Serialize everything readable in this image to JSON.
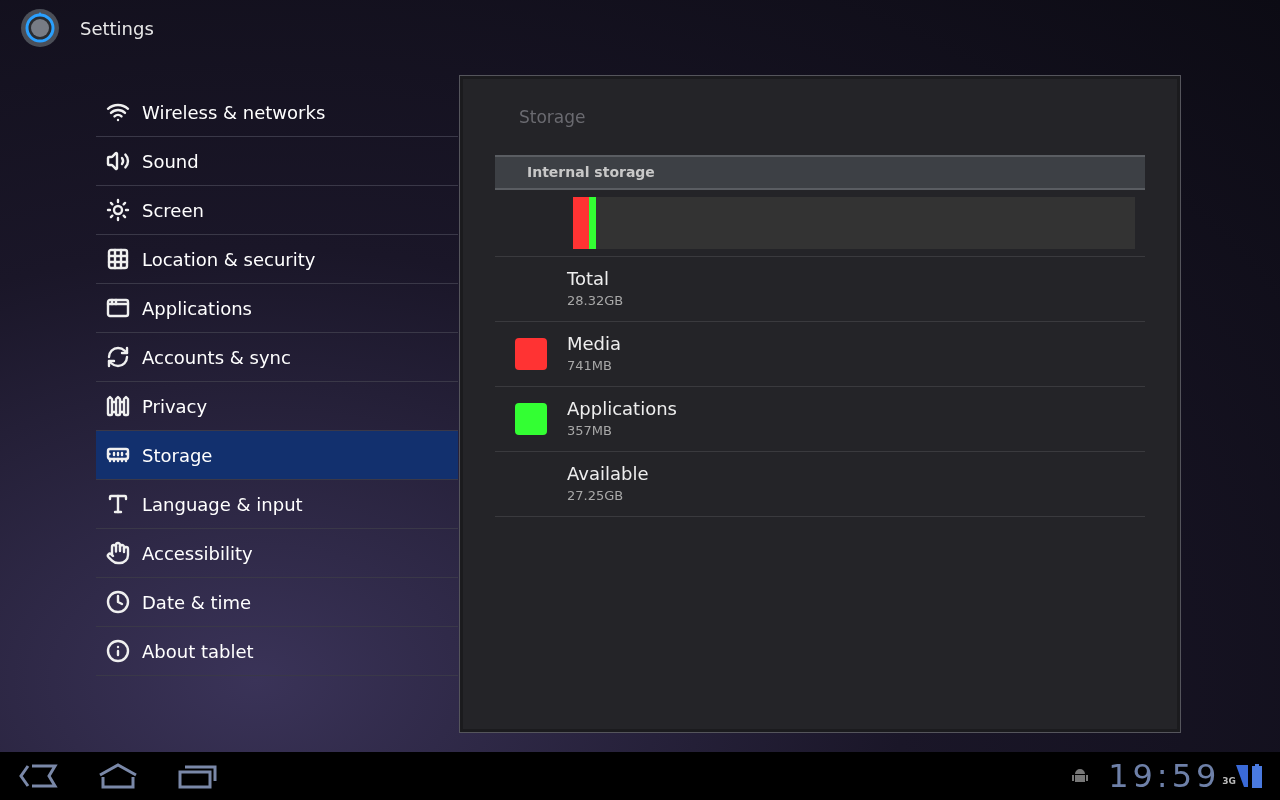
{
  "app_bar": {
    "title": "Settings"
  },
  "sidebar": {
    "items": [
      {
        "label": "Wireless & networks",
        "selected": false
      },
      {
        "label": "Sound",
        "selected": false
      },
      {
        "label": "Screen",
        "selected": false
      },
      {
        "label": "Location & security",
        "selected": false
      },
      {
        "label": "Applications",
        "selected": false
      },
      {
        "label": "Accounts & sync",
        "selected": false
      },
      {
        "label": "Privacy",
        "selected": false
      },
      {
        "label": "Storage",
        "selected": true
      },
      {
        "label": "Language & input",
        "selected": false
      },
      {
        "label": "Accessibility",
        "selected": false
      },
      {
        "label": "Date & time",
        "selected": false
      },
      {
        "label": "About tablet",
        "selected": false
      }
    ]
  },
  "panel": {
    "title": "Storage",
    "section": "Internal storage",
    "entries": [
      {
        "name": "Total",
        "value": "28.32GB"
      },
      {
        "name": "Media",
        "value": "741MB",
        "color": "#ff3333",
        "level": 0.028
      },
      {
        "name": "Applications",
        "value": "357MB",
        "color": "#33ff33",
        "level": 0.0125
      },
      {
        "name": "Available",
        "value": "27.25GB"
      }
    ]
  },
  "system_bar": {
    "time": "19:59",
    "network": "3G"
  }
}
